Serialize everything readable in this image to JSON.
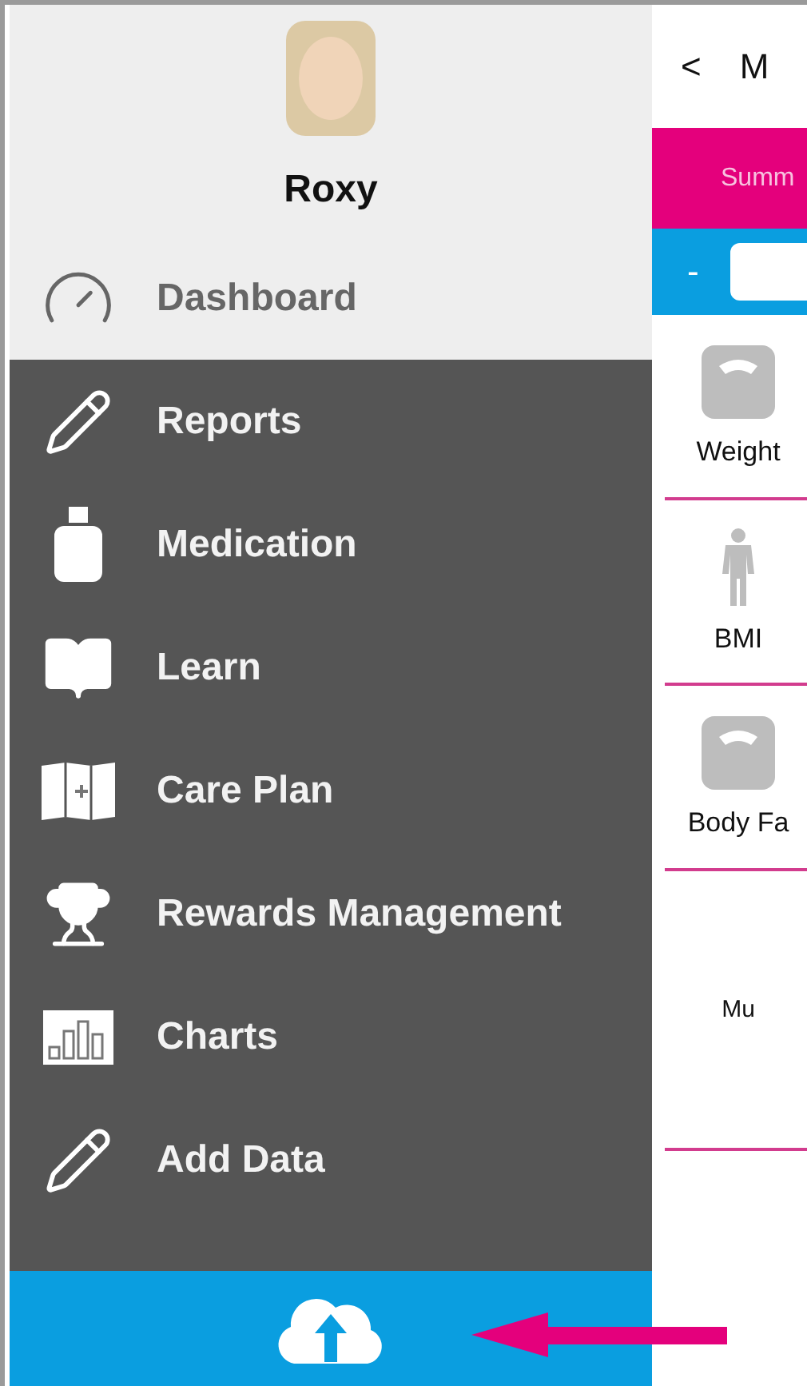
{
  "profile": {
    "name": "Roxy"
  },
  "sidebar": {
    "items": [
      {
        "label": "Dashboard",
        "selected": true
      },
      {
        "label": "Reports",
        "selected": false
      },
      {
        "label": "Medication",
        "selected": false
      },
      {
        "label": "Learn",
        "selected": false
      },
      {
        "label": "Care Plan",
        "selected": false
      },
      {
        "label": "Rewards Management",
        "selected": false
      },
      {
        "label": "Charts",
        "selected": false
      },
      {
        "label": "Add Data",
        "selected": false
      }
    ]
  },
  "header": {
    "back": "<",
    "title": "M"
  },
  "tab_bar": {
    "label": "Summ"
  },
  "stepper": {
    "minus": "-"
  },
  "metrics": [
    {
      "kind": "scale",
      "label": "Weight"
    },
    {
      "kind": "person",
      "label": "BMI"
    },
    {
      "kind": "scale",
      "label": "Body Fa"
    },
    {
      "kind": "none",
      "label": "Mu"
    }
  ]
}
